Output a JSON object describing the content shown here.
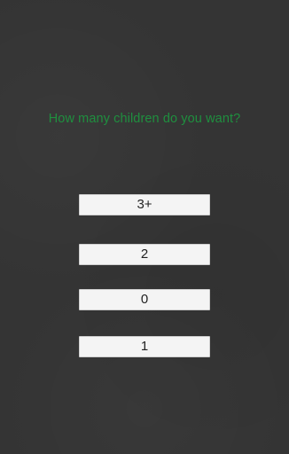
{
  "question": {
    "text": "How many children do you want?",
    "color": "#1f8f3f"
  },
  "answers": [
    {
      "label": "3+"
    },
    {
      "label": "2"
    },
    {
      "label": "0"
    },
    {
      "label": "1"
    }
  ],
  "colors": {
    "background": "#343434",
    "button_background": "#f4f4f4",
    "button_text": "#222222"
  }
}
